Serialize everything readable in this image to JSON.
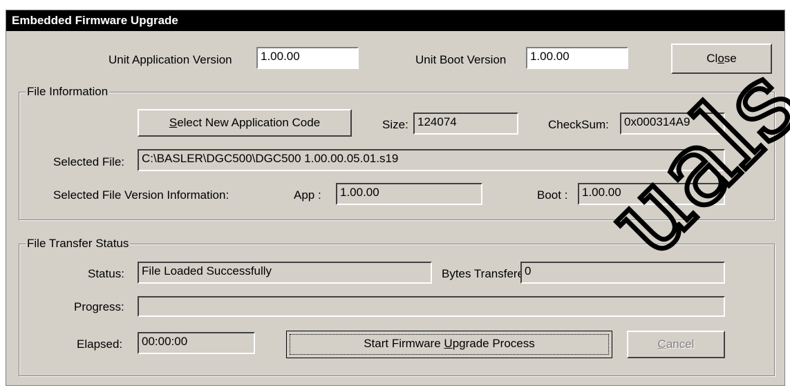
{
  "window": {
    "title": "Embedded Firmware Upgrade"
  },
  "unit": {
    "app_version_label": "Unit Application Version",
    "app_version_value": "1.00.00",
    "boot_version_label": "Unit Boot Version",
    "boot_version_value": "1.00.00",
    "close_label_pre": "Cl",
    "close_label_accel": "o",
    "close_label_post": "se"
  },
  "file_info": {
    "group_title": "File Information",
    "select_button_accel": "S",
    "select_button_rest": "elect New Application Code",
    "size_label": "Size:",
    "size_value": "124074",
    "checksum_label": "CheckSum:",
    "checksum_value": "0x000314A9",
    "selected_file_label": "Selected File:",
    "selected_file_value": "C:\\BASLER\\DGC500\\DGC500 1.00.00.05.01.s19",
    "version_info_label": "Selected File Version Information:",
    "app_label": "App :",
    "app_value": "1.00.00",
    "boot_label": "Boot :",
    "boot_value": "1.00.00"
  },
  "transfer": {
    "group_title": "File Transfer Status",
    "status_label": "Status:",
    "status_value": "File Loaded Successfully",
    "bytes_label": "Bytes Transfered",
    "bytes_value": "0",
    "progress_label": "Progress:",
    "progress_value": 0,
    "elapsed_label": "Elapsed:",
    "elapsed_value": "00:00:00",
    "start_pre": "Start Firmware ",
    "start_accel": "U",
    "start_post": "pgrade Process",
    "cancel_accel": "C",
    "cancel_rest": "ancel"
  },
  "watermark": {
    "text": "uals"
  }
}
